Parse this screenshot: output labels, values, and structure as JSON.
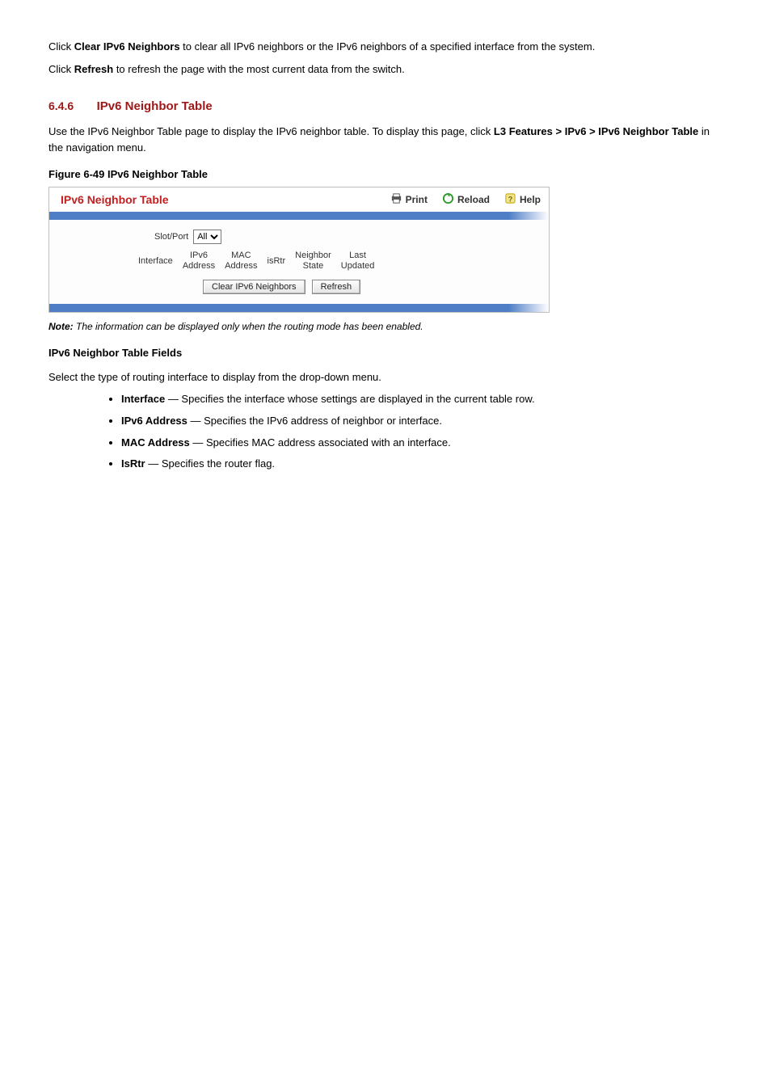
{
  "intro": {
    "p1_prefix": "Click ",
    "p1_bold": "Clear IPv6 Neighbors",
    "p1_suffix": " to clear all IPv6 neighbors or the IPv6 neighbors of a specified interface from the system.",
    "p2_prefix": "Click ",
    "p2_bold": "Refresh",
    "p2_suffix": " to refresh the page with the most current data from the switch."
  },
  "section": {
    "num": "6.4.6",
    "title": "IPv6 Neighbor Table"
  },
  "desc": {
    "text_prefix": "Use the IPv6 Neighbor Table page to display the IPv6 neighbor table. To display this page, click ",
    "path": "L3 Features > IPv6 > IPv6 Neighbor Table",
    "text_suffix": " in the navigation menu."
  },
  "figure": {
    "caption": "Figure 6-49  IPv6 Neighbor Table",
    "note_bold": "Note: ",
    "note_text": "The information can be displayed only when the routing mode has been enabled."
  },
  "panel": {
    "title": "IPv6 Neighbor Table",
    "actions": {
      "print": "Print",
      "reload": "Reload",
      "help": "Help"
    },
    "filter": {
      "label": "Slot/Port",
      "options": [
        "All"
      ],
      "selected": "All"
    },
    "columns": {
      "c0": "Interface",
      "c1": "IPv6\nAddress",
      "c2": "MAC\nAddress",
      "c3": "isRtr",
      "c4": "Neighbor\nState",
      "c5": "Last\nUpdated"
    },
    "buttons": {
      "clear": "Clear IPv6 Neighbors",
      "refresh": "Refresh"
    }
  },
  "fields": {
    "heading": "IPv6 Neighbor Table Fields",
    "intro": "Select the type of routing interface to display from the drop-down menu.",
    "items": [
      {
        "label": "Interface",
        "text": " —  Specifies the interface whose settings are displayed in the current table row."
      },
      {
        "label": "IPv6 Address",
        "text": " —  Specifies the IPv6 address of neighbor or interface."
      },
      {
        "label": "MAC Address",
        "text": " —  Specifies MAC address associated with an interface."
      },
      {
        "label": "IsRtr",
        "text": " —  Specifies the router flag."
      }
    ]
  }
}
